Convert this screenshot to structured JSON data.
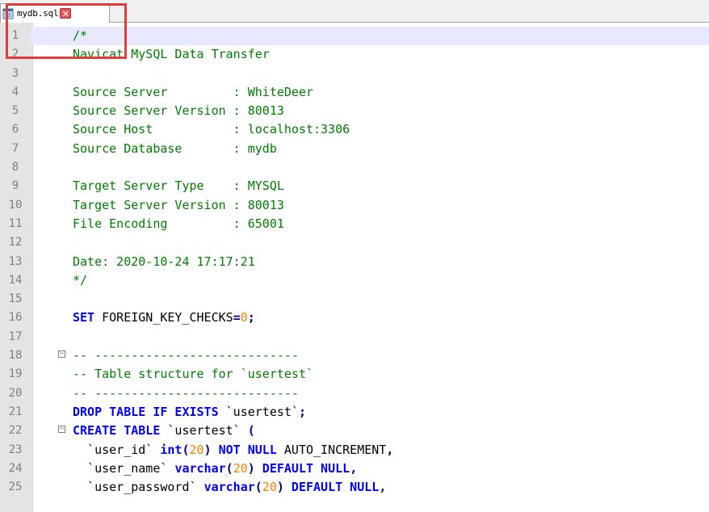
{
  "tab": {
    "label": "mydb.sql",
    "icon": "file-icon",
    "close_icon": "close-icon",
    "close_glyph": "✕"
  },
  "colors": {
    "comment": "#008000",
    "keyword": "#0000ff",
    "number": "#ff8000",
    "highlight_box": "#e03c3c",
    "current_line": "#e8e8ff"
  },
  "current_line": 1,
  "lines": [
    {
      "n": "1",
      "tokens": [
        {
          "t": "cm",
          "v": "/*"
        }
      ]
    },
    {
      "n": "2",
      "tokens": [
        {
          "t": "cm",
          "v": "Navicat MySQL Data Transfer"
        }
      ]
    },
    {
      "n": "3",
      "tokens": []
    },
    {
      "n": "4",
      "tokens": [
        {
          "t": "cm",
          "v": "Source Server         : WhiteDeer"
        }
      ]
    },
    {
      "n": "5",
      "tokens": [
        {
          "t": "cm",
          "v": "Source Server Version : 80013"
        }
      ]
    },
    {
      "n": "6",
      "tokens": [
        {
          "t": "cm",
          "v": "Source Host           : localhost:3306"
        }
      ]
    },
    {
      "n": "7",
      "tokens": [
        {
          "t": "cm",
          "v": "Source Database       : mydb"
        }
      ]
    },
    {
      "n": "8",
      "tokens": []
    },
    {
      "n": "9",
      "tokens": [
        {
          "t": "cm",
          "v": "Target Server Type    : MYSQL"
        }
      ]
    },
    {
      "n": "10",
      "tokens": [
        {
          "t": "cm",
          "v": "Target Server Version : 80013"
        }
      ]
    },
    {
      "n": "11",
      "tokens": [
        {
          "t": "cm",
          "v": "File Encoding         : 65001"
        }
      ]
    },
    {
      "n": "12",
      "tokens": []
    },
    {
      "n": "13",
      "tokens": [
        {
          "t": "cm",
          "v": "Date: 2020-10-24 17:17:21"
        }
      ]
    },
    {
      "n": "14",
      "tokens": [
        {
          "t": "cm",
          "v": "*/"
        }
      ]
    },
    {
      "n": "15",
      "tokens": []
    },
    {
      "n": "16",
      "tokens": [
        {
          "t": "kw",
          "v": "SET"
        },
        {
          "t": "id",
          "v": " FOREIGN_KEY_CHECKS"
        },
        {
          "t": "op",
          "v": "="
        },
        {
          "t": "num",
          "v": "0"
        },
        {
          "t": "op",
          "v": ";"
        }
      ]
    },
    {
      "n": "17",
      "tokens": []
    },
    {
      "n": "18",
      "fold": "⊟",
      "tokens": [
        {
          "t": "cm",
          "v": "-- ----------------------------"
        }
      ]
    },
    {
      "n": "19",
      "tokens": [
        {
          "t": "cm",
          "v": "-- Table structure for `usertest`"
        }
      ]
    },
    {
      "n": "20",
      "tokens": [
        {
          "t": "cm",
          "v": "-- ----------------------------"
        }
      ]
    },
    {
      "n": "21",
      "tokens": [
        {
          "t": "kw",
          "v": "DROP TABLE IF EXISTS"
        },
        {
          "t": "str",
          "v": " `usertest`"
        },
        {
          "t": "op",
          "v": ";"
        }
      ]
    },
    {
      "n": "22",
      "fold": "⊟",
      "tokens": [
        {
          "t": "kw",
          "v": "CREATE TABLE"
        },
        {
          "t": "str",
          "v": " `usertest` "
        },
        {
          "t": "op",
          "v": "("
        }
      ]
    },
    {
      "n": "23",
      "tokens": [
        {
          "t": "str",
          "v": "  `user_id` "
        },
        {
          "t": "kw",
          "v": "int"
        },
        {
          "t": "op",
          "v": "("
        },
        {
          "t": "num",
          "v": "20"
        },
        {
          "t": "op",
          "v": ")"
        },
        {
          "t": "kw",
          "v": " NOT NULL"
        },
        {
          "t": "id",
          "v": " AUTO_INCREMENT"
        },
        {
          "t": "op",
          "v": ","
        }
      ]
    },
    {
      "n": "24",
      "tokens": [
        {
          "t": "str",
          "v": "  `user_name` "
        },
        {
          "t": "kw",
          "v": "varchar"
        },
        {
          "t": "op",
          "v": "("
        },
        {
          "t": "num",
          "v": "20"
        },
        {
          "t": "op",
          "v": ")"
        },
        {
          "t": "kw",
          "v": " DEFAULT NULL"
        },
        {
          "t": "op",
          "v": ","
        }
      ]
    },
    {
      "n": "25",
      "tokens": [
        {
          "t": "str",
          "v": "  `user_password` "
        },
        {
          "t": "kw",
          "v": "varchar"
        },
        {
          "t": "op",
          "v": "("
        },
        {
          "t": "num",
          "v": "20"
        },
        {
          "t": "op",
          "v": ")"
        },
        {
          "t": "kw",
          "v": " DEFAULT NULL"
        },
        {
          "t": "op",
          "v": ","
        }
      ]
    }
  ]
}
